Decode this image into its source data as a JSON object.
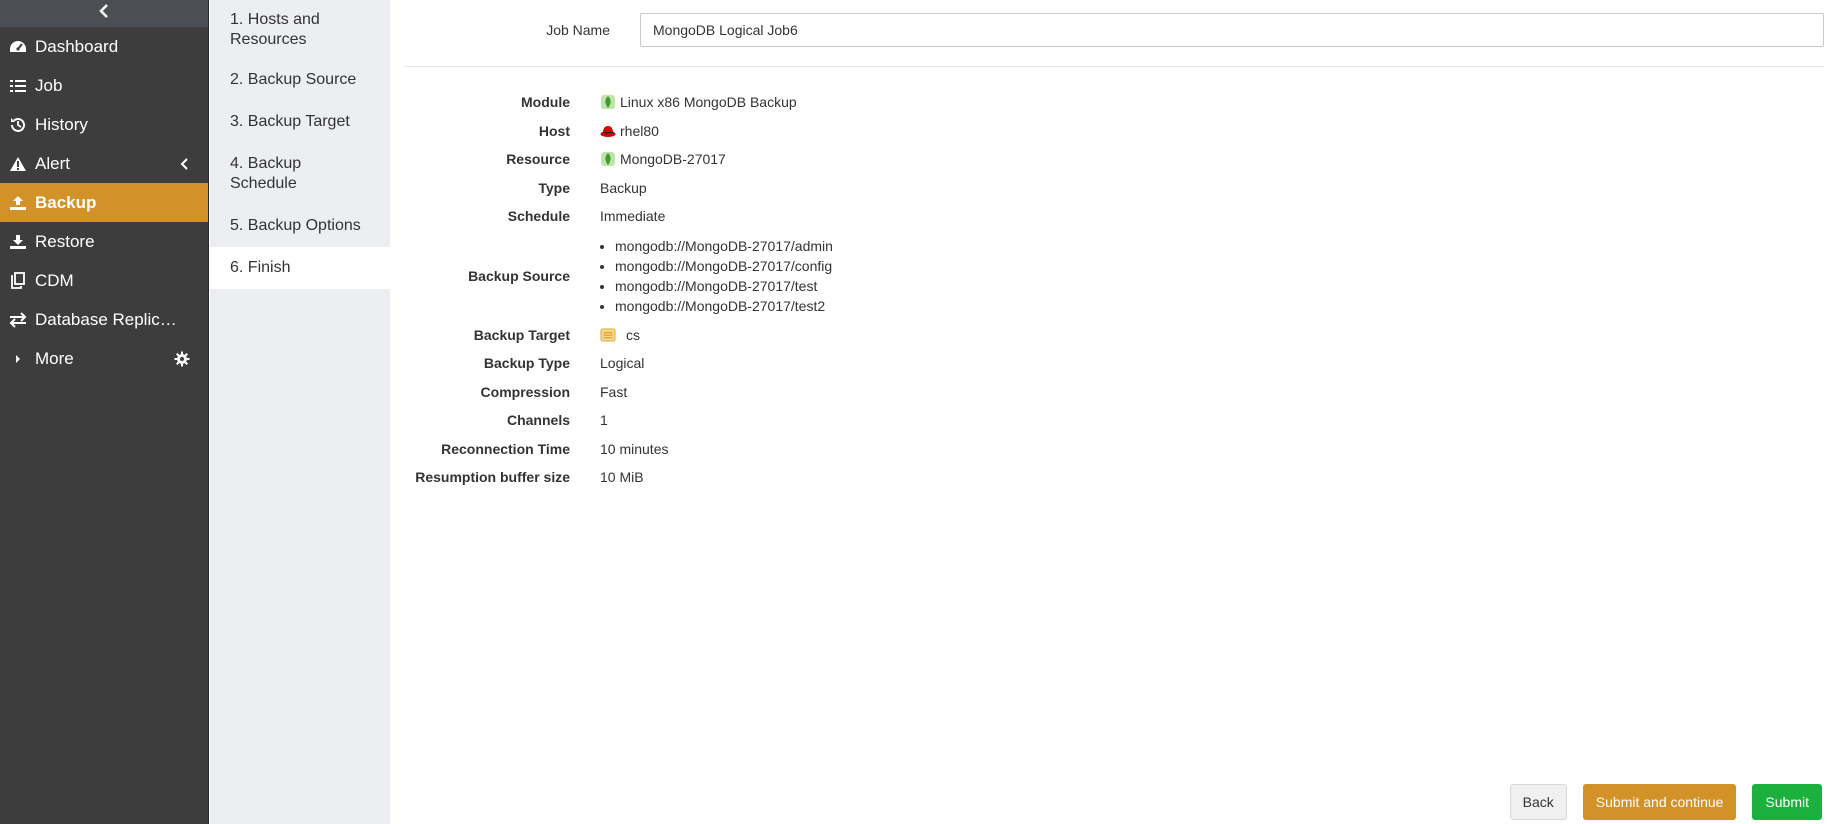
{
  "sidebar": {
    "items": [
      {
        "label": "Dashboard",
        "icon": "dashboard-icon"
      },
      {
        "label": "Job",
        "icon": "list-icon"
      },
      {
        "label": "History",
        "icon": "history-icon"
      },
      {
        "label": "Alert",
        "icon": "warning-icon"
      },
      {
        "label": "Backup",
        "icon": "upload-icon"
      },
      {
        "label": "Restore",
        "icon": "download-icon"
      },
      {
        "label": "CDM",
        "icon": "copy-icon"
      },
      {
        "label": "Database Replication",
        "icon": "exchange-icon"
      },
      {
        "label": "More",
        "icon": "caret-right-icon"
      }
    ],
    "active": "Backup"
  },
  "steps": [
    {
      "label": "1. Hosts and Resources"
    },
    {
      "label": "2. Backup Source"
    },
    {
      "label": "3. Backup Target"
    },
    {
      "label": "4. Backup Schedule"
    },
    {
      "label": "5. Backup Options"
    },
    {
      "label": "6. Finish"
    }
  ],
  "form": {
    "job_name_label": "Job Name",
    "job_name_value": "MongoDB Logical Job6"
  },
  "summary": {
    "module_label": "Module",
    "module_value": "Linux x86 MongoDB Backup",
    "host_label": "Host",
    "host_value": "rhel80",
    "resource_label": "Resource",
    "resource_value": "MongoDB-27017",
    "type_label": "Type",
    "type_value": "Backup",
    "schedule_label": "Schedule",
    "schedule_value": "Immediate",
    "source_label": "Backup Source",
    "sources": [
      "mongodb://MongoDB-27017/admin",
      "mongodb://MongoDB-27017/config",
      "mongodb://MongoDB-27017/test",
      "mongodb://MongoDB-27017/test2"
    ],
    "target_label": "Backup Target",
    "target_value": "cs",
    "backup_type_label": "Backup Type",
    "backup_type_value": "Logical",
    "compression_label": "Compression",
    "compression_value": "Fast",
    "channels_label": "Channels",
    "channels_value": "1",
    "reconnection_label": "Reconnection Time",
    "reconnection_value": "10 minutes",
    "buffer_label": "Resumption buffer size",
    "buffer_value": "10 MiB"
  },
  "footer": {
    "back_label": "Back",
    "submit_continue_label": "Submit and continue",
    "submit_label": "Submit"
  },
  "colors": {
    "sidebar_bg": "#3d3d3d",
    "accent": "#d39227",
    "submit": "#1cb13e"
  }
}
